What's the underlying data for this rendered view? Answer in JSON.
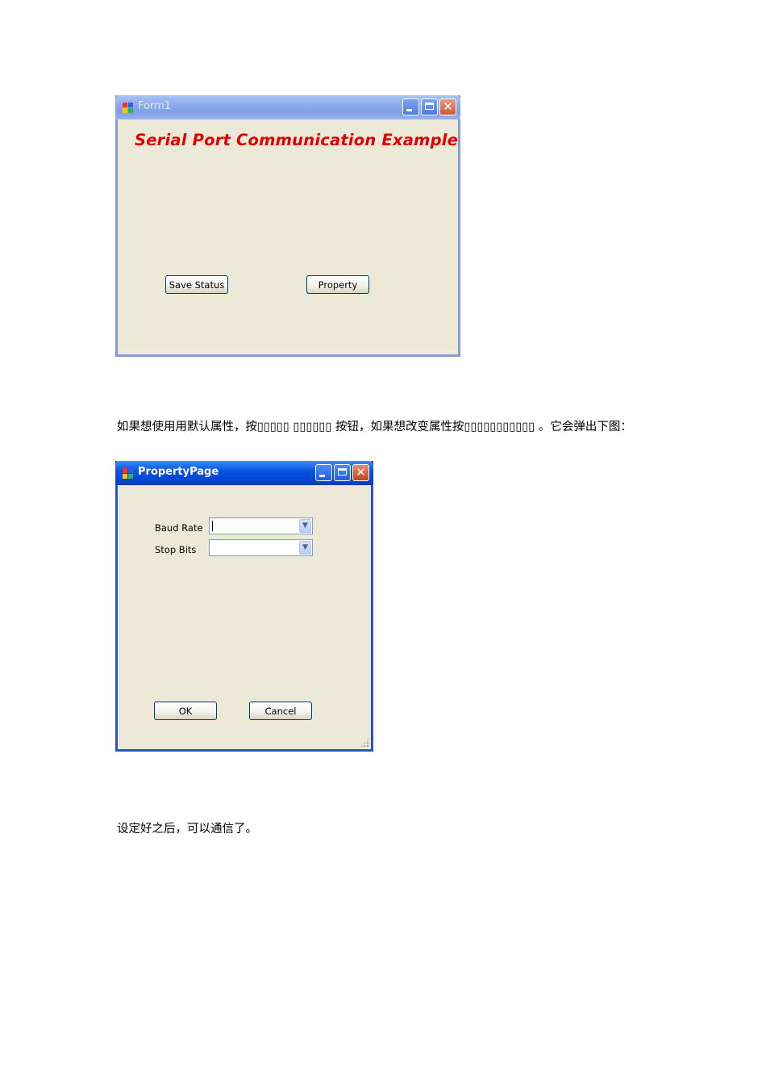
{
  "form1": {
    "title": "Form1",
    "headline": "Serial Port Communication Example",
    "save_status_label": "Save Status",
    "property_label": "Property"
  },
  "paragraph1": {
    "text": "如果想使用用默认属性，按▯▯▯▯▯    ▯▯▯▯▯▯   按钮，如果想改变属性按▯▯▯▯▯▯▯▯▯▯▯     。它会弹出下图："
  },
  "property_page": {
    "title": "PropertyPage",
    "baud_rate_label": "Baud Rate",
    "baud_rate_value": "",
    "stop_bits_label": "Stop Bits",
    "stop_bits_value": "",
    "ok_label": "OK",
    "cancel_label": "Cancel"
  },
  "paragraph2": {
    "text": "设定好之后，可以通信了。"
  },
  "icons": {
    "dropdown": "chevron-down-icon",
    "close": "close-icon",
    "minimize": "minimize-icon",
    "maximize": "maximize-icon",
    "app": "app-icon"
  },
  "colors": {
    "headline": "#e00000",
    "window_face": "#ece9d8",
    "titlebar_active": "#0548d9",
    "titlebar_inactive": "#8ba9e9"
  }
}
